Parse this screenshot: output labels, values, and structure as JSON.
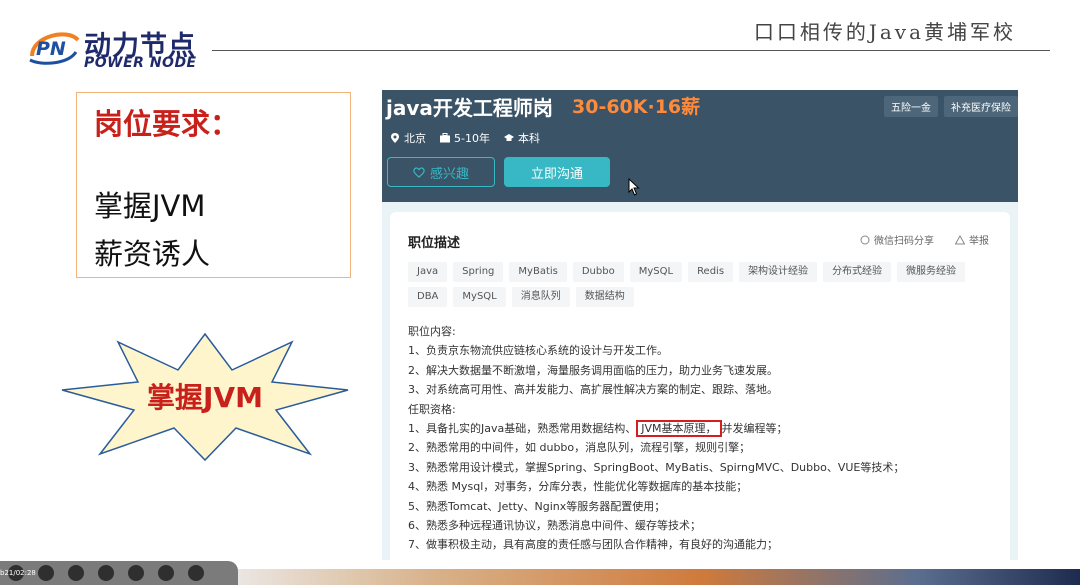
{
  "header": {
    "logo_cn": "动力节点",
    "logo_en": "POWER NODE",
    "slogan": "口口相传的Java黄埔军校"
  },
  "requirements": {
    "title": "岗位要求：",
    "items": [
      "掌握JVM",
      "薪资诱人"
    ]
  },
  "starburst": {
    "text": "掌握JVM"
  },
  "job": {
    "title": "java开发工程师岗",
    "salary": "30-60K·16薪",
    "location": "北京",
    "experience": "5-10年",
    "education": "本科",
    "benefits": [
      "五险一金",
      "补充医疗保险"
    ],
    "interest_button": "感兴趣",
    "chat_button": "立即沟通",
    "description": {
      "title": "职位描述",
      "share": "微信扫码分享",
      "report": "举报",
      "tags": [
        "Java",
        "Spring",
        "MyBatis",
        "Dubbo",
        "MySQL",
        "Redis",
        "架构设计经验",
        "分布式经验",
        "微服务经验",
        "DBA",
        "MySQL",
        "消息队列",
        "数据结构"
      ],
      "content_header": "职位内容:",
      "content": [
        "1、负责京东物流供应链核心系统的设计与开发工作。",
        "2、解决大数据量不断激增，海量服务调用面临的压力，助力业务飞速发展。",
        "3、对系统高可用性、高并发能力、高扩展性解决方案的制定、跟踪、落地。"
      ],
      "qual_header": "任职资格:",
      "qual1_pre": "1、具备扎实的Java基础，熟悉常用数据结构、",
      "qual1_hl": "JVM基本原理，",
      "qual1_post": "并发编程等；",
      "quals": [
        "2、熟悉常用的中间件，如 dubbo，消息队列，流程引擎，规则引擎；",
        "3、熟悉常用设计模式，掌握Spring、SpringBoot、MyBatis、SpirngMVC、Dubbo、VUE等技术；",
        "4、熟悉 Mysql，对事务，分库分表，性能优化等数据库的基本技能；",
        "5、熟悉Tomcat、Jetty、Nginx等服务器配置使用；",
        "6、熟悉多种远程通讯协议，熟悉消息中间件、缓存等技术；",
        "7、做事积极主动，具有高度的责任感与团队合作精神，有良好的沟通能力；"
      ]
    }
  },
  "toolbar": {
    "time": "b21/02:28"
  }
}
